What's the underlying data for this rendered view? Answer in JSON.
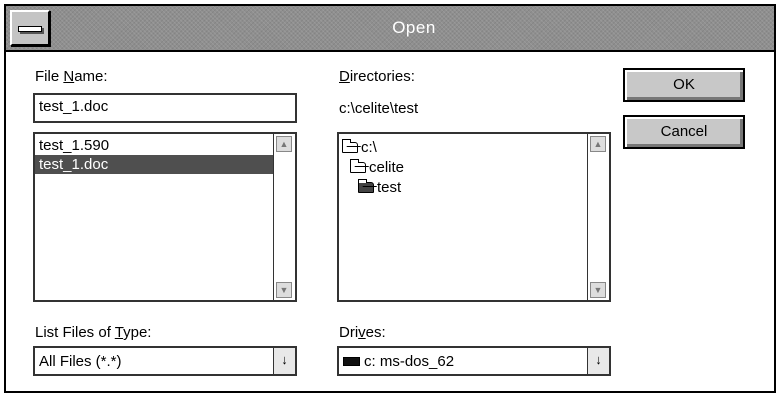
{
  "window": {
    "title": "Open"
  },
  "file_name": {
    "label_before": "File ",
    "label_accel": "N",
    "label_after": "ame:",
    "value": "test_1.doc",
    "files": [
      {
        "name": "test_1.590",
        "selected": false
      },
      {
        "name": "test_1.doc",
        "selected": true
      }
    ]
  },
  "directories": {
    "label_accel": "D",
    "label_after": "irectories:",
    "path": "c:\\celite\\test",
    "tree": [
      {
        "name": "c:\\",
        "level": 0,
        "icon": "open-folder-icon"
      },
      {
        "name": "celite",
        "level": 1,
        "icon": "open-folder-icon"
      },
      {
        "name": "test",
        "level": 2,
        "icon": "open-folder-icon"
      }
    ]
  },
  "file_type": {
    "label_before": "List Files of ",
    "label_accel": "T",
    "label_after": "ype:",
    "value": "All Files (*.*)"
  },
  "drives": {
    "label_before": "Dri",
    "label_accel": "v",
    "label_after": "es:",
    "value": "c: ms-dos_62",
    "icon": "hard-drive-icon"
  },
  "buttons": {
    "ok": "OK",
    "cancel": "Cancel"
  },
  "icons": {
    "dropdown": "↓",
    "scroll_up": "▲",
    "scroll_down": "▼"
  }
}
